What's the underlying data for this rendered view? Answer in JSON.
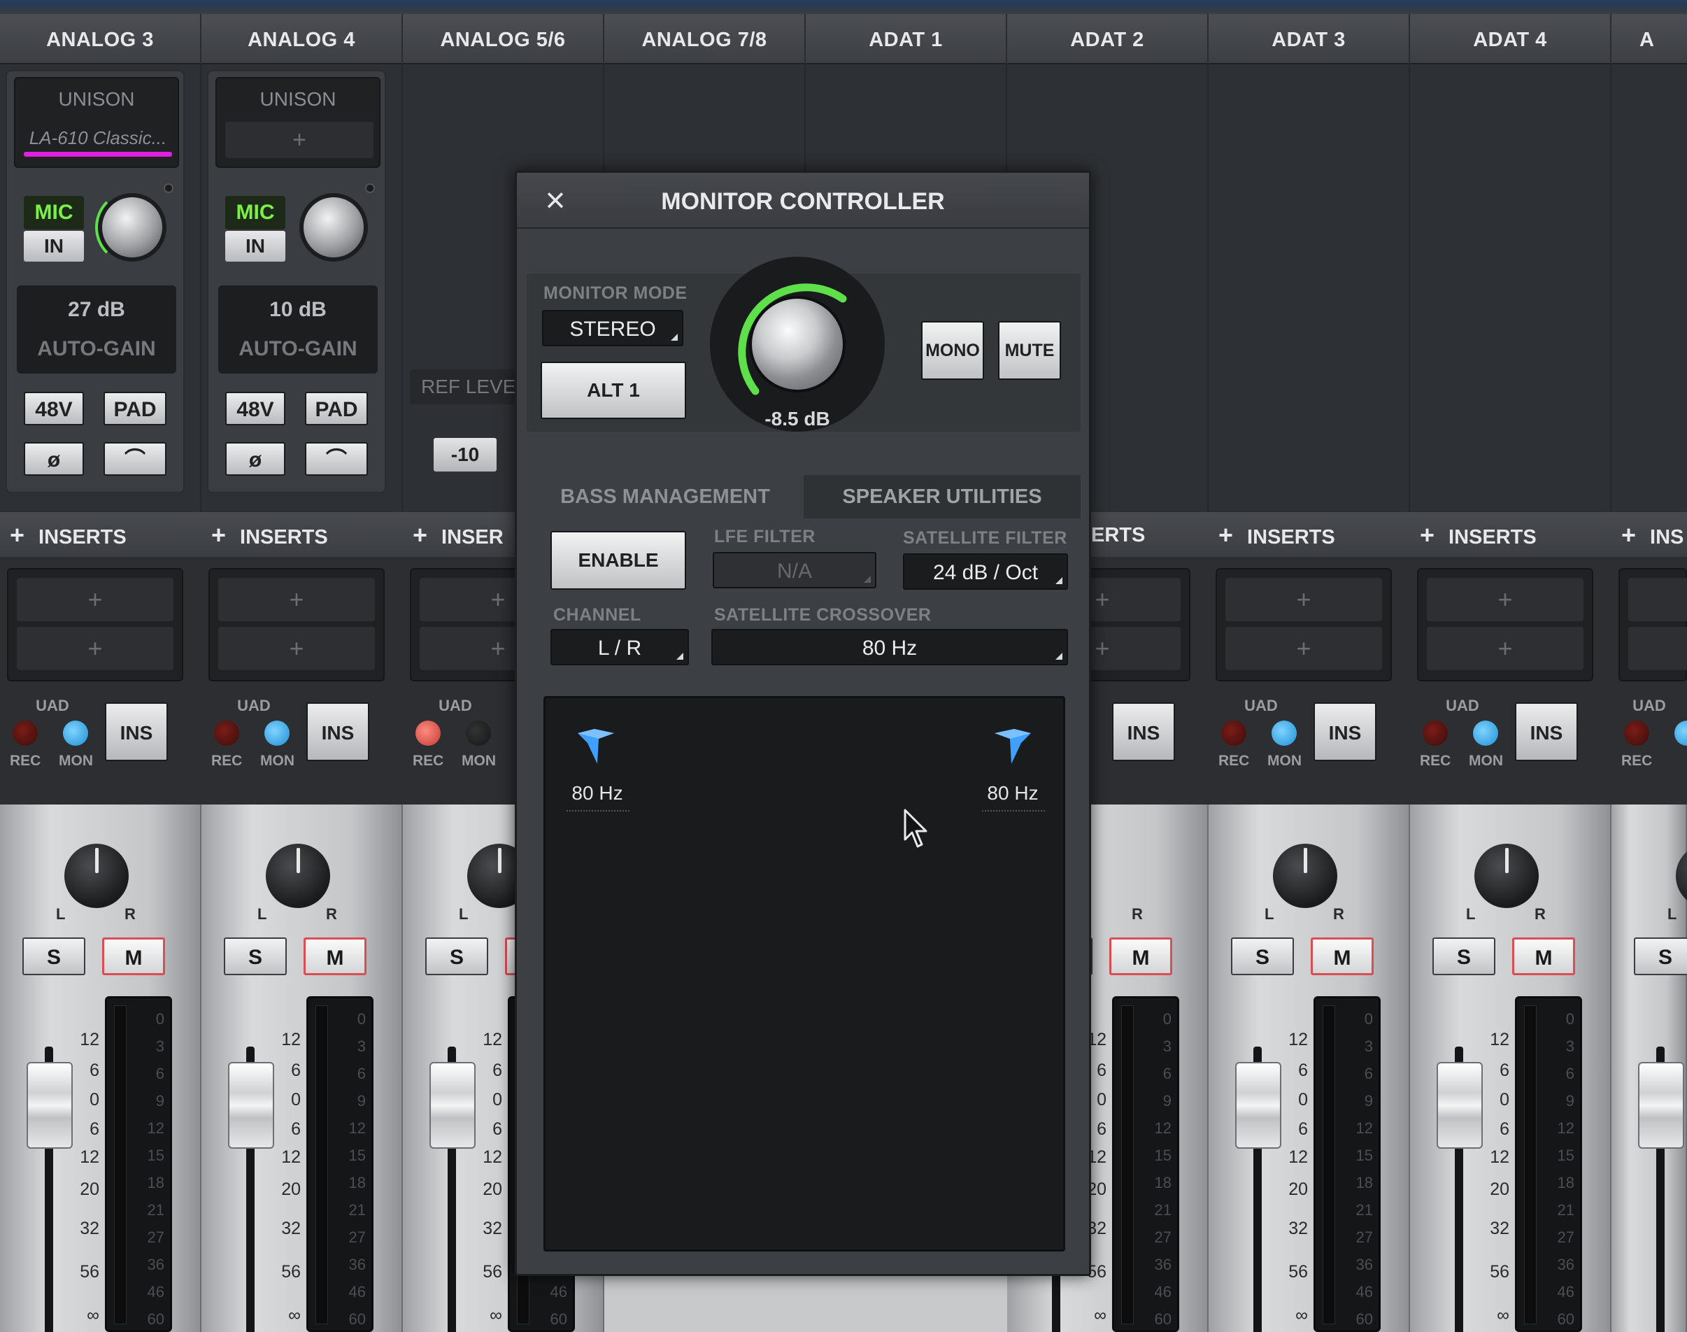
{
  "channels": [
    "ANALOG 3",
    "ANALOG 4",
    "ANALOG 5/6",
    "ANALOG 7/8",
    "ADAT 1",
    "ADAT 2",
    "ADAT 3",
    "ADAT 4",
    "A"
  ],
  "preamps": [
    {
      "unison": "UNISON",
      "plugin": "LA-610 Classic...",
      "mic": "MIC",
      "in": "IN",
      "gain": "27 dB",
      "auto_gain": "AUTO-GAIN",
      "phantom": "48V",
      "pad": "PAD",
      "phase": "ø",
      "hpf": "⌒"
    },
    {
      "unison": "UNISON",
      "plugin": "+",
      "mic": "MIC",
      "in": "IN",
      "gain": "10 dB",
      "auto_gain": "AUTO-GAIN",
      "phantom": "48V",
      "pad": "PAD",
      "phase": "ø",
      "hpf": "⌒"
    }
  ],
  "ref_level": {
    "label": "REF LEVEL",
    "value": "-10"
  },
  "inserts": {
    "label": "INSERTS",
    "partial_label": "INSER",
    "partial_label_b": "ERTS",
    "partial_label_c": "INS",
    "slot_plus": "+"
  },
  "io": {
    "uad": "UAD",
    "rec": "REC",
    "mon": "MON",
    "ins": "INS"
  },
  "strip": {
    "solo": "S",
    "mute": "M",
    "pan_l": "L",
    "pan_r": "R"
  },
  "fader_scale": [
    "12",
    "6",
    "0",
    "6",
    "12",
    "20",
    "32",
    "56",
    "∞"
  ],
  "meter_scale": [
    "0",
    "3",
    "6",
    "9",
    "12",
    "15",
    "18",
    "21",
    "27",
    "36",
    "46",
    "60"
  ],
  "modal": {
    "title": "MONITOR CONTROLLER",
    "close_icon": "×",
    "monitor_mode_label": "MONITOR MODE",
    "monitor_mode_value": "STEREO",
    "alt_button": "ALT 1",
    "volume": "-8.5 dB",
    "mono": "MONO",
    "mute": "MUTE",
    "tabs": [
      "BASS MANAGEMENT",
      "SPEAKER UTILITIES"
    ],
    "enable": "ENABLE",
    "lfe_filter_label": "LFE FILTER",
    "lfe_filter_value": "N/A",
    "satellite_filter_label": "SATELLITE FILTER",
    "satellite_filter_value": "24 dB / Oct",
    "channel_label": "CHANNEL",
    "channel_value": "L / R",
    "satellite_crossover_label": "SATELLITE CROSSOVER",
    "satellite_crossover_value": "80 Hz",
    "speaker_left_freq": "80 Hz",
    "speaker_right_freq": "80 Hz"
  },
  "colors": {
    "accent_green": "#5ee04a",
    "unison_magenta": "#e020e0",
    "speaker_blue": "#3fa0ff",
    "mute_red": "#d94d55"
  }
}
